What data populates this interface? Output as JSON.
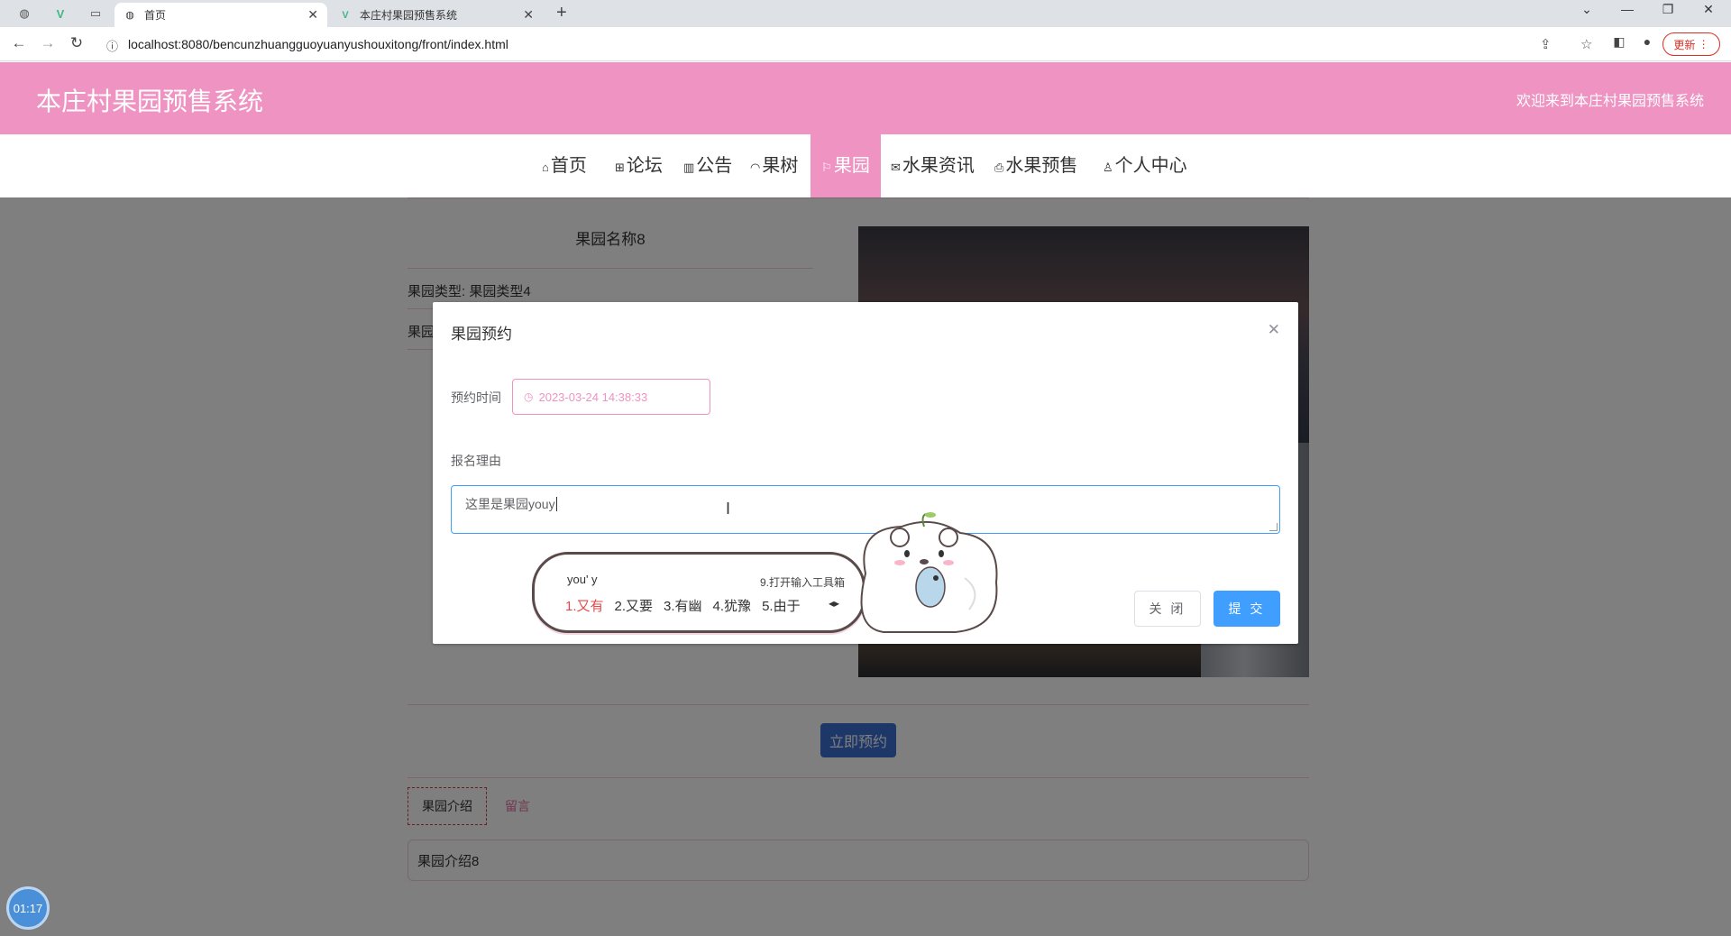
{
  "browser": {
    "tabs": [
      {
        "title": "首页",
        "active": true
      },
      {
        "title": "本庄村果园预售系统",
        "active": false
      }
    ],
    "url": "localhost:8080/bencunzhuangguoyuanyushouxitong/front/index.html",
    "update_label": "更新"
  },
  "site": {
    "title": "本庄村果园预售系统",
    "welcome": "欢迎来到本庄村果园预售系统"
  },
  "menu": [
    {
      "label": "首页",
      "icon": "home-icon",
      "active": false
    },
    {
      "label": "论坛",
      "icon": "forum-icon",
      "active": false
    },
    {
      "label": "公告",
      "icon": "notice-icon",
      "active": false
    },
    {
      "label": "果树",
      "icon": "tree-icon",
      "active": false
    },
    {
      "label": "果园",
      "icon": "flag-icon",
      "active": true
    },
    {
      "label": "水果资讯",
      "icon": "mail-icon",
      "active": false
    },
    {
      "label": "水果预售",
      "icon": "print-icon",
      "active": false
    },
    {
      "label": "个人中心",
      "icon": "user-icon",
      "active": false
    }
  ],
  "detail": {
    "name": "果园名称8",
    "type_label": "果园类型: 果园类型4",
    "field2_label": "果园",
    "reserve_button": "立即预约",
    "tabs": {
      "intro": "果园介绍",
      "message": "留言"
    },
    "intro_text": "果园介绍8"
  },
  "dialog": {
    "title": "果园预约",
    "time_label": "预约时间",
    "time_value": "2023-03-24 14:38:33",
    "reason_label": "报名理由",
    "reason_value": "这里是果园youy",
    "close_button": "关 闭",
    "submit_button": "提 交"
  },
  "ime": {
    "composition": "you' y",
    "toolbox": "9.打开输入工具箱",
    "candidates": [
      "1.又有",
      "2.又要",
      "3.有幽",
      "4.犹豫",
      "5.由于"
    ]
  },
  "timer": "01:17",
  "colors": {
    "brand_pink": "#ee93c2",
    "primary_blue": "#409eff",
    "reserve_blue": "#3a6fd0"
  }
}
